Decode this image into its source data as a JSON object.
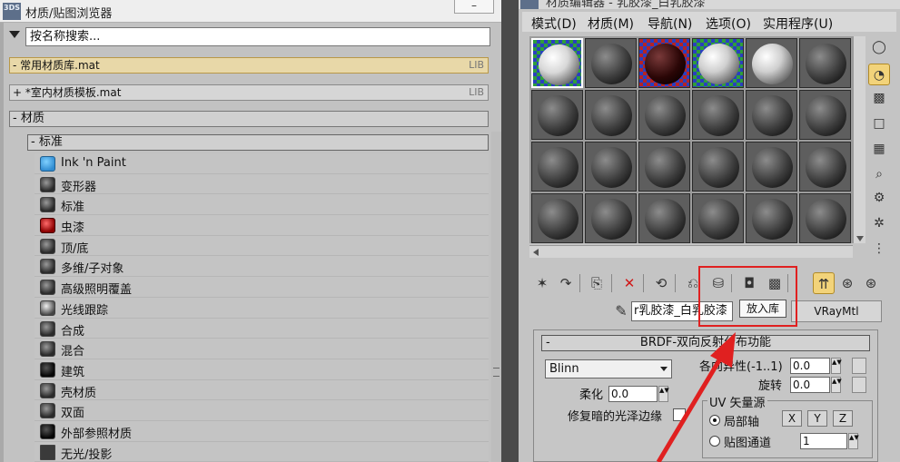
{
  "browser": {
    "app_icon": "3DS",
    "title": "材质/贴图浏览器",
    "minimize_label": "–",
    "search_placeholder": "按名称搜索...",
    "libraries": [
      {
        "label": "- 常用材质库.mat",
        "tag": "LIB"
      },
      {
        "label": "+ *室内材质模板.mat",
        "tag": "LIB"
      }
    ],
    "group_label": "- 材质",
    "subgroup_label": "- 标准",
    "materials": [
      {
        "label": "Ink 'n Paint",
        "icon": "ink-paint-icon"
      },
      {
        "label": "变形器",
        "icon": "sphere-icon"
      },
      {
        "label": "标准",
        "icon": "sphere-icon"
      },
      {
        "label": "虫漆",
        "icon": "red-sphere-icon"
      },
      {
        "label": "顶/底",
        "icon": "sphere-icon"
      },
      {
        "label": "多维/子对象",
        "icon": "sphere-icon"
      },
      {
        "label": "高级照明覆盖",
        "icon": "sphere-icon"
      },
      {
        "label": "光线跟踪",
        "icon": "raytrace-sphere-icon"
      },
      {
        "label": "合成",
        "icon": "sphere-icon"
      },
      {
        "label": "混合",
        "icon": "sphere-icon"
      },
      {
        "label": "建筑",
        "icon": "dark-sphere-icon"
      },
      {
        "label": "壳材质",
        "icon": "sphere-icon"
      },
      {
        "label": "双面",
        "icon": "sphere-icon"
      },
      {
        "label": "外部参照材质",
        "icon": "dark-sphere-icon"
      },
      {
        "label": "无光/投影",
        "icon": "flat-swatch-icon"
      }
    ]
  },
  "editor": {
    "app_icon": "3DS",
    "title": "材质编辑器 - 乳胶漆_白乳胶漆",
    "menu": [
      "模式(D)",
      "材质(M)",
      "导航(N)",
      "选项(O)",
      "实用程序(U)"
    ],
    "material_name": "r乳胶漆_白乳胶漆",
    "material_type": "VRayMtl",
    "tooltip": "放入库",
    "rollout_title": "BRDF-双向反射分布功能",
    "brdf_type": "Blinn",
    "anisotropy_label": "各向异性(-1..1)",
    "anisotropy_value": "0.0",
    "rotation_label": "旋转",
    "rotation_value": "0.0",
    "soften_label": "柔化",
    "soften_value": "0.0",
    "fix_dark_edges_label": "修复暗的光泽边缘",
    "uv_source_label": "UV 矢量源",
    "local_axis_label": "局部轴",
    "map_channel_label": "贴图通道",
    "map_channel_value": "1",
    "axis_buttons": [
      "X",
      "Y",
      "Z"
    ],
    "colors": {
      "highlight": "#e02020",
      "active_tool": "#f2d37a"
    }
  }
}
